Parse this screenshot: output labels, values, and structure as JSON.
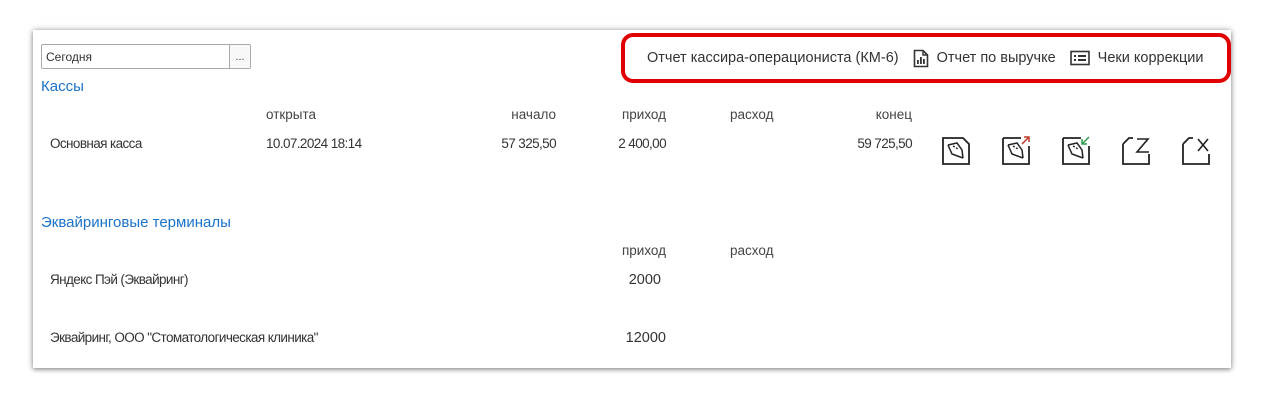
{
  "period": {
    "value": "Сегодня",
    "button": "..."
  },
  "toolbar": {
    "cashier_report": "Отчет кассира-операциониста (КМ-6)",
    "revenue_report": "Отчет по выручке",
    "correction_receipts": "Чеки коррекции",
    "highlight_color": "#e00000"
  },
  "cash_registers": {
    "title": "Кассы",
    "columns": {
      "opened": "открыта",
      "start": "начало",
      "income": "приход",
      "expense": "расход",
      "end": "конец"
    },
    "rows": [
      {
        "name": "Основная касса",
        "opened": "10.07.2024 18:14",
        "start": "57 325,50",
        "income": "2 400,00",
        "expense": "",
        "end": "59 725,50"
      }
    ],
    "actions": [
      "register-icon",
      "cash-in-icon",
      "cash-out-icon",
      "z-report-icon",
      "x-report-icon"
    ]
  },
  "terminals": {
    "title": "Эквайринговые терминалы",
    "columns": {
      "income": "приход",
      "expense": "расход"
    },
    "rows": [
      {
        "name": "Яндекс Пэй (Эквайринг)",
        "income": "2000",
        "expense": ""
      },
      {
        "name": "Эквайринг, ООО \"Стоматологическая клиника\"",
        "income": "12000",
        "expense": ""
      }
    ]
  },
  "colors": {
    "section_title": "#1a73c8",
    "cash_in_arrow": "#c0392b",
    "cash_out_arrow": "#2e9e4f"
  }
}
